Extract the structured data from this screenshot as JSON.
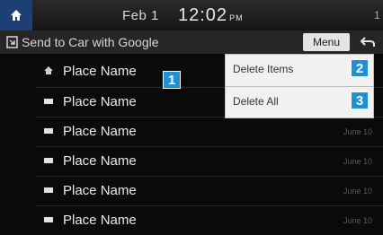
{
  "status": {
    "date": "Feb 1",
    "time": "12:02",
    "ampm": "PM",
    "edge": "1"
  },
  "titlebar": {
    "title": "Send to Car with Google",
    "menu_label": "Menu"
  },
  "list": {
    "items": [
      {
        "name": "Place Name",
        "date": "",
        "icon": "home-icon"
      },
      {
        "name": "Place Name",
        "date": "",
        "icon": "place-icon"
      },
      {
        "name": "Place Name",
        "date": "June 10",
        "icon": "place-icon"
      },
      {
        "name": "Place Name",
        "date": "June 10",
        "icon": "place-icon"
      },
      {
        "name": "Place Name",
        "date": "June 10",
        "icon": "place-icon"
      },
      {
        "name": "Place Name",
        "date": "June 10",
        "icon": "place-icon"
      }
    ]
  },
  "popup": {
    "items": [
      {
        "label": "Delete Items"
      },
      {
        "label": "Delete All"
      }
    ]
  },
  "callouts": [
    "1",
    "2",
    "3"
  ],
  "colors": {
    "home_button": "#1d3f73",
    "callout": "#1f8fd6",
    "popup_bg": "#f1f1f1",
    "menu_button": "#e4e4e4"
  }
}
